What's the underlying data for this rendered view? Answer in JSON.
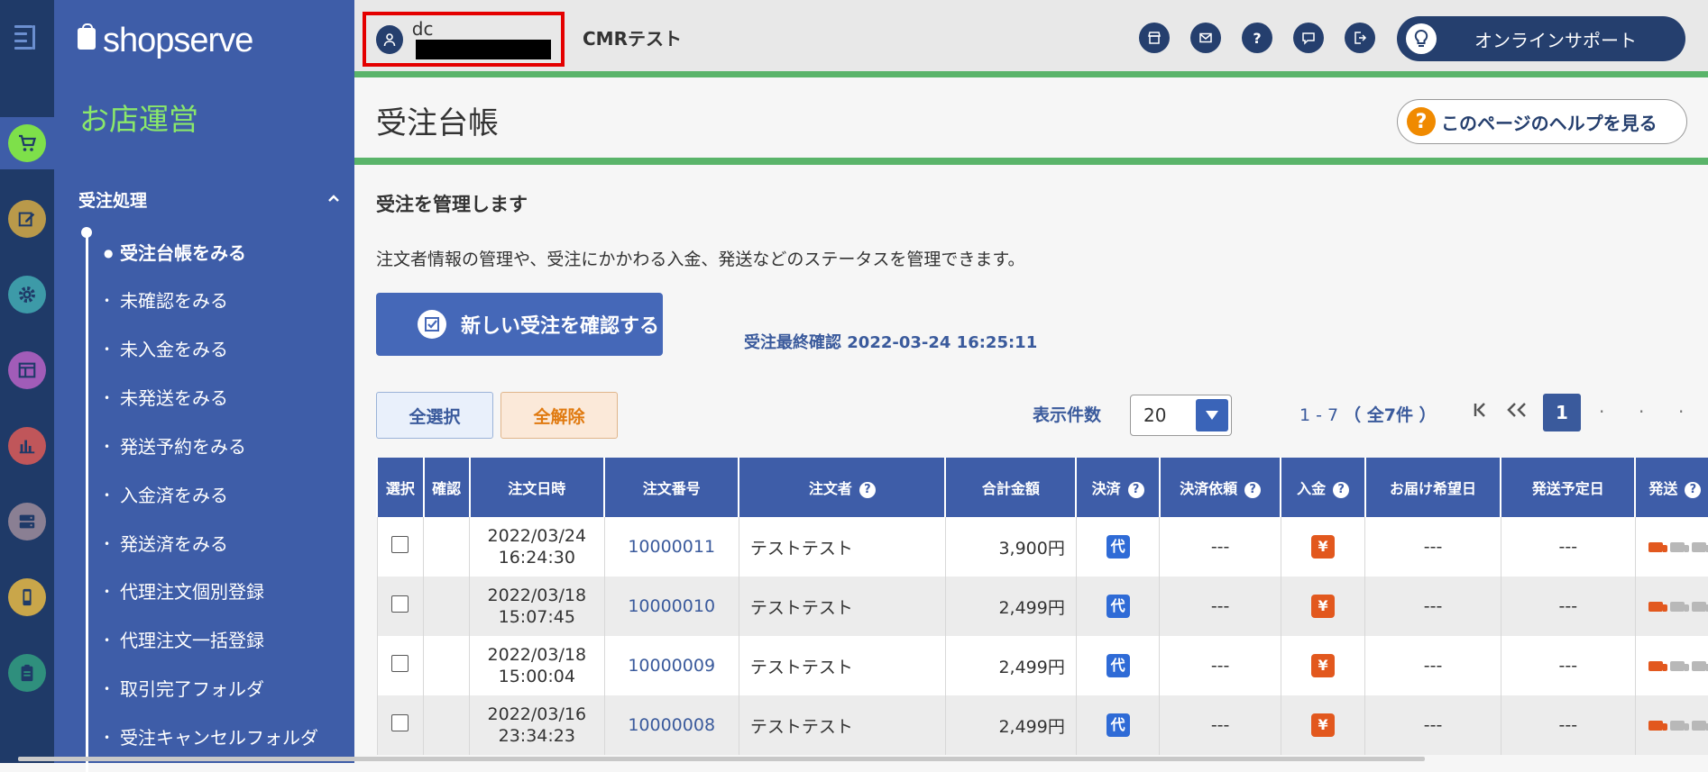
{
  "rail": {
    "items": [
      {
        "icon": "cart-icon",
        "color": "#7ee04a"
      },
      {
        "icon": "edit-icon",
        "color": "#b9994a"
      },
      {
        "icon": "gear-icon",
        "color": "#3d9aa8"
      },
      {
        "icon": "layout-icon",
        "color": "#a15cb8"
      },
      {
        "icon": "bar-chart-icon",
        "color": "#c0565a"
      },
      {
        "icon": "server-icon",
        "color": "#8a7f93"
      },
      {
        "icon": "mobile-icon",
        "color": "#c9a64a"
      },
      {
        "icon": "clipboard-icon",
        "color": "#2f8f7d"
      }
    ]
  },
  "sidebar": {
    "logo": "shopserve",
    "section_title": "お店運営",
    "group_title": "受注処理",
    "items": [
      {
        "label": "受注台帳をみる",
        "active": true
      },
      {
        "label": "未確認をみる"
      },
      {
        "label": "未入金をみる"
      },
      {
        "label": "未発送をみる"
      },
      {
        "label": "発送予約をみる"
      },
      {
        "label": "入金済をみる"
      },
      {
        "label": "発送済をみる"
      },
      {
        "label": "代理注文個別登録"
      },
      {
        "label": "代理注文一括登録"
      },
      {
        "label": "取引完了フォルダ"
      },
      {
        "label": "受注キャンセルフォルダ"
      }
    ]
  },
  "topbar": {
    "user_id_prefix": "dc",
    "shop_name": "CMRテスト",
    "icons": [
      "store-icon",
      "mail-icon",
      "help-icon",
      "chat-icon",
      "logout-icon"
    ],
    "support_label": "オンラインサポート"
  },
  "page": {
    "title": "受注台帳",
    "help_label": "このページのヘルプを見る",
    "lead": "受注を管理します",
    "description": "注文者情報の管理や、受注にかかわる入金、発送などのステータスを管理できます。",
    "confirm_button": "新しい受注を確認する",
    "last_check": "受注最終確認 2022-03-24 16:25:11"
  },
  "controls": {
    "select_all": "全選択",
    "deselect_all": "全解除",
    "per_page_label": "表示件数",
    "per_page_value": "20",
    "range": "1 - 7",
    "total": "（ 全7件 ）",
    "current_page": "1"
  },
  "table": {
    "headers": {
      "select": "選択",
      "confirm": "確認",
      "date": "注文日時",
      "order_no": "注文番号",
      "customer": "注文者",
      "amount": "合計金額",
      "payment": "決済",
      "payment_request": "決済依頼",
      "deposit": "入金",
      "delivery_date": "お届け希望日",
      "ship_date": "発送予定日",
      "shipping": "発送"
    },
    "rows": [
      {
        "date": "2022/03/24",
        "time": "16:24:30",
        "order_no": "10000011",
        "customer": "テストテスト",
        "amount": "3,900円",
        "payment": "代",
        "payment_request": "---",
        "deposit": "¥",
        "delivery_date": "---",
        "ship_date": "---"
      },
      {
        "date": "2022/03/18",
        "time": "15:07:45",
        "order_no": "10000010",
        "customer": "テストテスト",
        "amount": "2,499円",
        "payment": "代",
        "payment_request": "---",
        "deposit": "¥",
        "delivery_date": "---",
        "ship_date": "---"
      },
      {
        "date": "2022/03/18",
        "time": "15:00:04",
        "order_no": "10000009",
        "customer": "テストテスト",
        "amount": "2,499円",
        "payment": "代",
        "payment_request": "---",
        "deposit": "¥",
        "delivery_date": "---",
        "ship_date": "---"
      },
      {
        "date": "2022/03/16",
        "time": "23:34:23",
        "order_no": "10000008",
        "customer": "テストテスト",
        "amount": "2,499円",
        "payment": "代",
        "payment_request": "---",
        "deposit": "¥",
        "delivery_date": "---",
        "ship_date": "---"
      }
    ]
  },
  "colors": {
    "sidebar_bg": "#3e5da8",
    "rail_bg": "#1f3a68",
    "accent_green": "#5ab46a",
    "navy": "#253f6e",
    "highlight_red": "#e40000"
  }
}
